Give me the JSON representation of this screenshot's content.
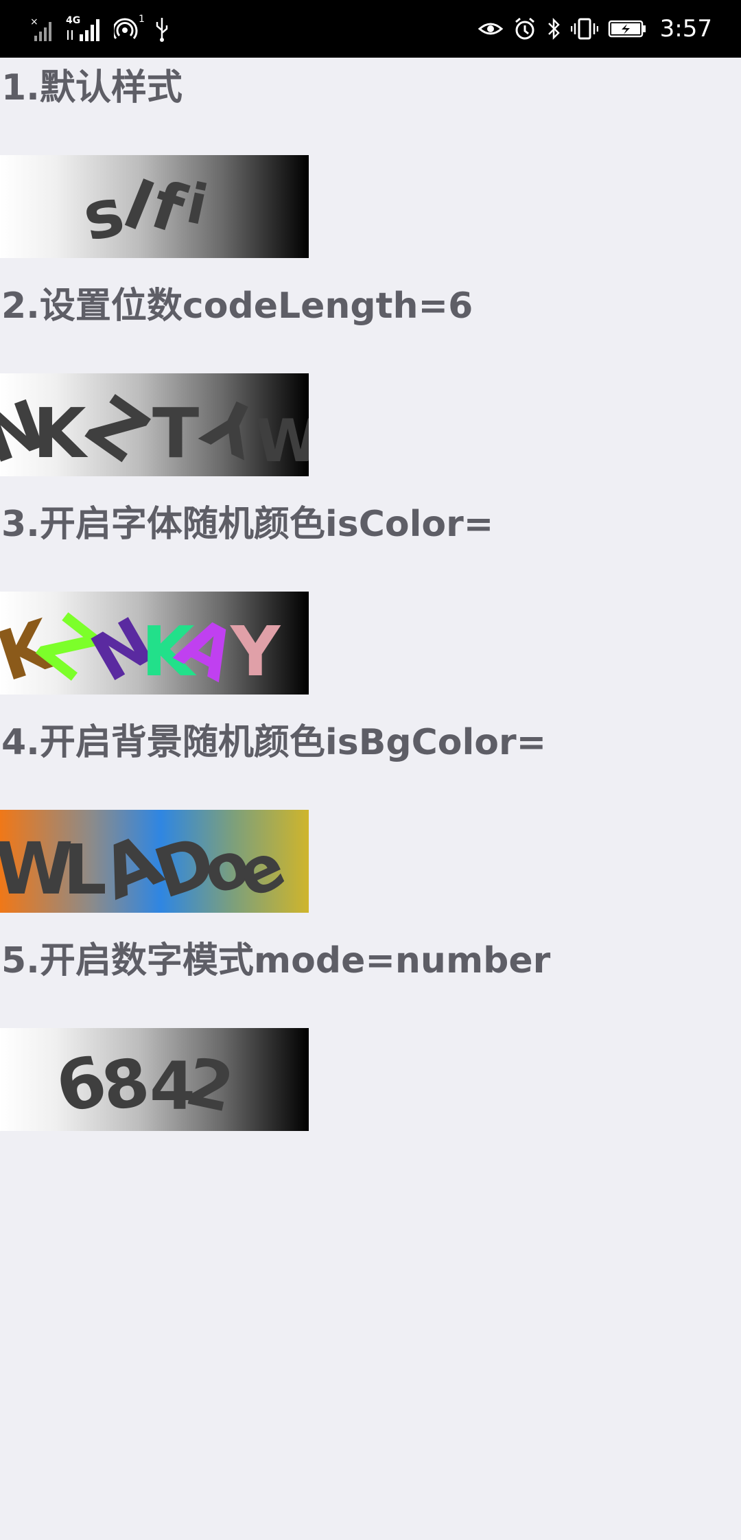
{
  "status_bar": {
    "clock": "3:57",
    "network_label": "4G",
    "hotspot_count": "1",
    "icons": [
      "no-sim-signal-icon",
      "mobile-signal-icon",
      "hotspot-icon",
      "usb-icon",
      "eye-comfort-icon",
      "alarm-icon",
      "bluetooth-icon",
      "vibrate-icon",
      "battery-charging-icon"
    ]
  },
  "sections": [
    {
      "title": "1.默认样式",
      "captcha": [
        "s",
        "l",
        "f",
        "i"
      ]
    },
    {
      "title": "2.设置位数codeLength=6",
      "captcha": [
        "N",
        "K",
        "Z",
        "T",
        "Y",
        "W"
      ]
    },
    {
      "title": "3.开启字体随机颜色isColor=",
      "captcha": [
        "K",
        "Z",
        "N",
        "K",
        "A",
        "Y"
      ],
      "char_colors": [
        "#8b5a1a",
        "#7cff2a",
        "#5a2aa0",
        "#22e08a",
        "#c040f0",
        "#e0a0a8"
      ]
    },
    {
      "title": "4.开启背景随机颜色isBgColor=",
      "captcha": [
        "W",
        "L",
        "A",
        "D",
        "o",
        "e"
      ]
    },
    {
      "title": "5.开启数字模式mode=number",
      "captcha": [
        "6",
        "8",
        "4",
        "2"
      ]
    }
  ],
  "colors": {
    "status_bar_bg": "#000000",
    "page_bg": "#efeff4",
    "title_text": "#5e5e66",
    "captcha_text": "#3f3f3f"
  }
}
